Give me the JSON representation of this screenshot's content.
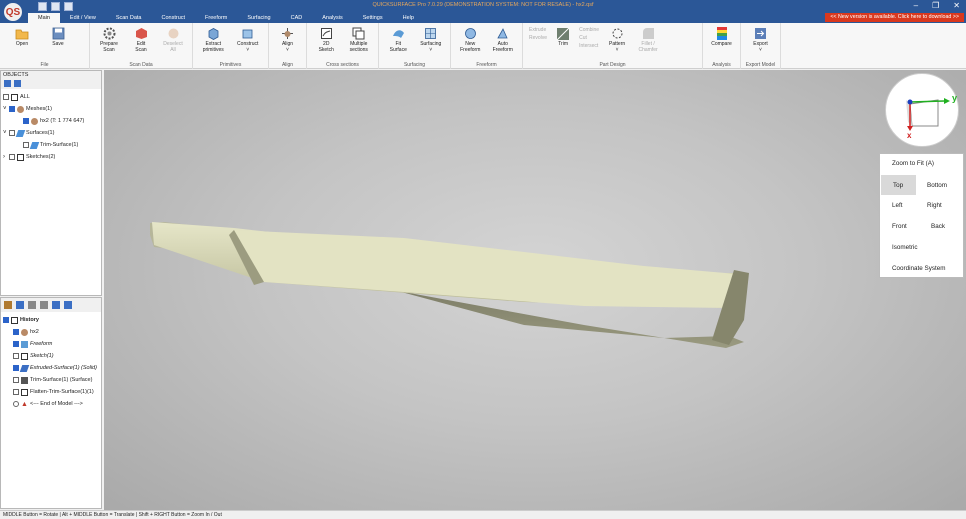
{
  "window": {
    "title": "QUICKSURFACE Pro 7.0.29 (DEMONSTRATION SYSTEM: NOT FOR RESALE) - hx2.qsf",
    "logo_text": "QS",
    "controls": [
      "–",
      "❐",
      "✕"
    ]
  },
  "notice": "<< New version is available. Click here to download >>",
  "tabs": [
    "Main",
    "Edit / View",
    "Scan Data",
    "Construct",
    "Freeform",
    "Surfacing",
    "CAD",
    "Analysis",
    "Settings",
    "Help"
  ],
  "ribbon": {
    "file": {
      "title": "File",
      "open": "Open",
      "save": "Save"
    },
    "scan": {
      "title": "Scan Data",
      "prepare": [
        "Prepare",
        "Scan"
      ],
      "edit": [
        "Edit",
        "Scan"
      ],
      "deselect": [
        "Deselect",
        "All"
      ]
    },
    "prim": {
      "title": "Primitives",
      "extract": [
        "Extract",
        "primitives"
      ],
      "construct": [
        "Construct",
        "˅"
      ]
    },
    "align": {
      "title": "Align",
      "label": [
        "Align",
        "˅"
      ]
    },
    "cross": {
      "title": "Cross sections",
      "sketch": [
        "2D",
        "Sketch"
      ],
      "multiple": [
        "Multiple",
        "sections"
      ]
    },
    "surf": {
      "title": "Surfacing",
      "fit": [
        "Fit",
        "Surface"
      ],
      "surfacing": [
        "Surfacing",
        "˅"
      ]
    },
    "free": {
      "title": "Freeform",
      "new": [
        "New",
        "Freeform"
      ],
      "auto": [
        "Auto",
        "Freeform"
      ]
    },
    "part": {
      "title": "Part Design",
      "extrude": "Extrude",
      "revolve": "Revolve",
      "trim": "Trim",
      "combine": "Combine",
      "cut": "Cut",
      "intersect": "Intersect",
      "pattern": [
        "Pattern",
        "˅"
      ],
      "fillet": [
        "Fillet /",
        "Chamfer"
      ]
    },
    "analysis": {
      "title": "Analysis",
      "compare": "Compare"
    },
    "export": {
      "title": "Export Model",
      "label": [
        "Export",
        "˅"
      ]
    }
  },
  "objects": {
    "label": "OBJECTS",
    "items": [
      {
        "text": "ALL",
        "checked": false
      },
      {
        "text": "Meshes(1)",
        "checked": true
      },
      {
        "text": "hx2 (T: 1 774 647)",
        "checked": true
      },
      {
        "text": "Surfaces(1)",
        "checked": false
      },
      {
        "text": "Trim-Surface(1)",
        "checked": false
      },
      {
        "text": "Sketches(2)",
        "checked": false
      }
    ]
  },
  "history": {
    "items": [
      {
        "text": "History",
        "checked": true
      },
      {
        "text": "hx2",
        "checked": true
      },
      {
        "text": "Freeform",
        "checked": true
      },
      {
        "text": "Sketch(1)",
        "checked": false
      },
      {
        "text": "Extruded-Surface(1) (Solid)",
        "checked": true
      },
      {
        "text": "Trim-Surface(1) (Surface)",
        "checked": false
      },
      {
        "text": "Flatten-Trim-Surface(1)(1)",
        "checked": false
      },
      {
        "text": "<--- End of Model --->",
        "checked": false
      }
    ]
  },
  "gizmo": {
    "y": "y",
    "x": "x"
  },
  "view_menu": {
    "zoom": "Zoom to Fit (A)",
    "top": "Top",
    "bottom": "Bottom",
    "left": "Left",
    "right": "Right",
    "front": "Front",
    "back": "Back",
    "iso": "Isometric",
    "coord": "Coordinate System"
  },
  "status": "MIDDLE Button = Rotate | Alt + MIDDLE Button = Translate | Shift + RIGHT Button = Zoom In / Out",
  "colors": {
    "titlebar": "#2b5797",
    "notice": "#d9381e",
    "mesh": "#dcdcb8"
  }
}
